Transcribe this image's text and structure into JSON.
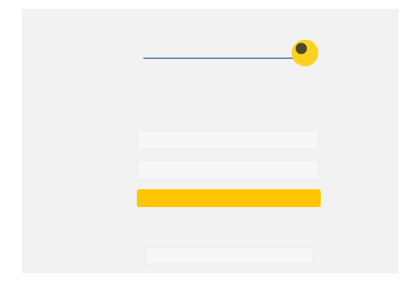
{
  "header": {
    "logo_text": "",
    "badge_icon": "yellow-round-badge"
  },
  "login": {
    "title": "",
    "subtitle": ""
  },
  "form": {
    "email_placeholder": "",
    "password_placeholder": "",
    "submit_label": ""
  },
  "links": {
    "forgot_password": "",
    "divider": "",
    "register_label": "",
    "footer": ""
  },
  "colors": {
    "background": "#f2f2f2",
    "accent": "#ffc600",
    "link": "#5f86b0"
  }
}
